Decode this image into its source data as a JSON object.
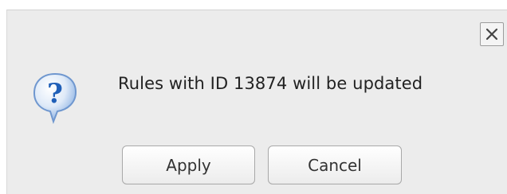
{
  "dialog": {
    "message": "Rules with ID 13874 will be updated",
    "apply_label": "Apply",
    "cancel_label": "Cancel",
    "close_icon": "close-icon",
    "question_icon": "question-icon"
  },
  "colors": {
    "dialog_background": "#ececec",
    "icon_blue": "#1f5fb8"
  }
}
